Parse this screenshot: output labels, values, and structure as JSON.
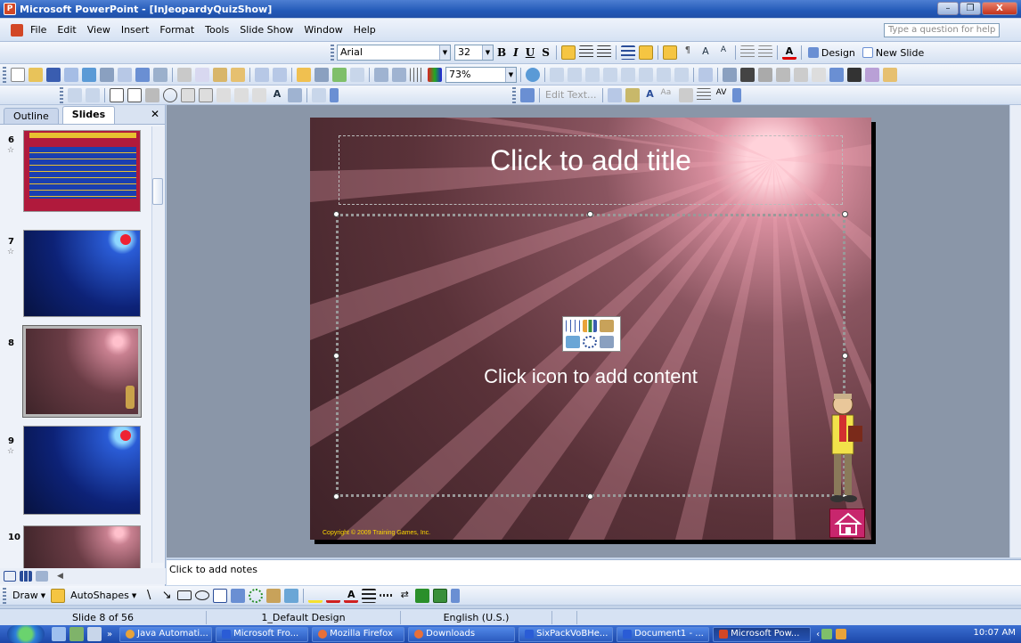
{
  "window": {
    "title": "Microsoft PowerPoint - [InJeopardyQuizShow]",
    "app_icon": "P"
  },
  "menu": {
    "items": [
      "File",
      "Edit",
      "View",
      "Insert",
      "Format",
      "Tools",
      "Slide Show",
      "Window",
      "Help"
    ],
    "help_placeholder": "Type a question for help"
  },
  "formatting": {
    "font": "Arial",
    "size": "32",
    "design_label": "Design",
    "new_slide_label": "New Slide"
  },
  "standard": {
    "zoom": "73%"
  },
  "picture_toolbar": {
    "edit_text_label": "Edit Text..."
  },
  "pane": {
    "tabs": [
      "Outline",
      "Slides"
    ],
    "slides": [
      {
        "number": "6"
      },
      {
        "number": "7"
      },
      {
        "number": "8"
      },
      {
        "number": "9"
      },
      {
        "number": "10"
      }
    ]
  },
  "slide": {
    "title_placeholder": "Click to add title",
    "body_placeholder": "Click icon to add content",
    "copyright": "Copyright © 2009 Training Games, Inc."
  },
  "notes": {
    "placeholder": "Click to add notes"
  },
  "drawing": {
    "draw_label": "Draw",
    "autoshapes_label": "AutoShapes"
  },
  "status": {
    "slide": "Slide 8 of 56",
    "design": "1_Default Design",
    "language": "English (U.S.)"
  },
  "taskbar": {
    "tasks": [
      "Java Automati...",
      "Microsoft Fro...",
      "Mozilla Firefox",
      "Downloads",
      "SixPackVoBHe...",
      "Document1 - ...",
      "Microsoft Pow..."
    ],
    "clock": "10:07 AM"
  },
  "colors": {
    "accent": "#245ab8",
    "slide_bg": "#5a3239",
    "home_button": "#c8266d"
  }
}
